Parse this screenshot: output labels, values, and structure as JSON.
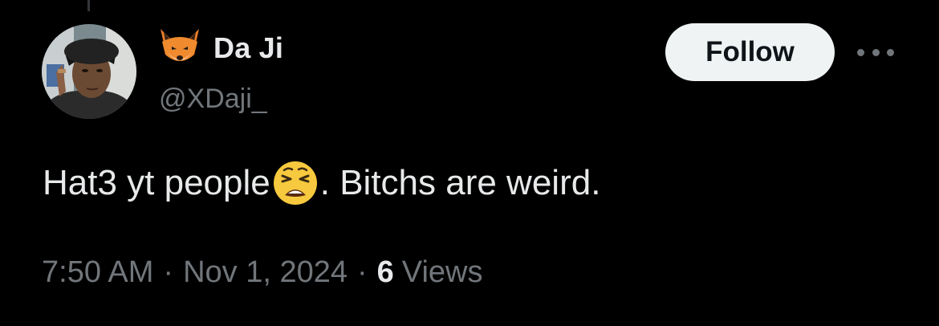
{
  "tweet": {
    "author": {
      "display_name": "Da Ji",
      "handle": "@XDaji_",
      "name_icon": "fox-face-icon",
      "avatar": "avatar"
    },
    "follow_label": "Follow",
    "more_icon": "more-options-icon",
    "text_before_emoji": "Hat3 yt people",
    "emoji": "weary-face-icon",
    "text_after_emoji": ". Bitchs are weird.",
    "time": "7:50 AM",
    "separator": "·",
    "date": "Nov 1, 2024",
    "views_count": "6",
    "views_label": "Views"
  },
  "colors": {
    "background": "#000000",
    "primary_text": "#e7e9ea",
    "secondary_text": "#71767b",
    "follow_button_bg": "#eff3f4",
    "follow_button_text": "#0f1419"
  }
}
